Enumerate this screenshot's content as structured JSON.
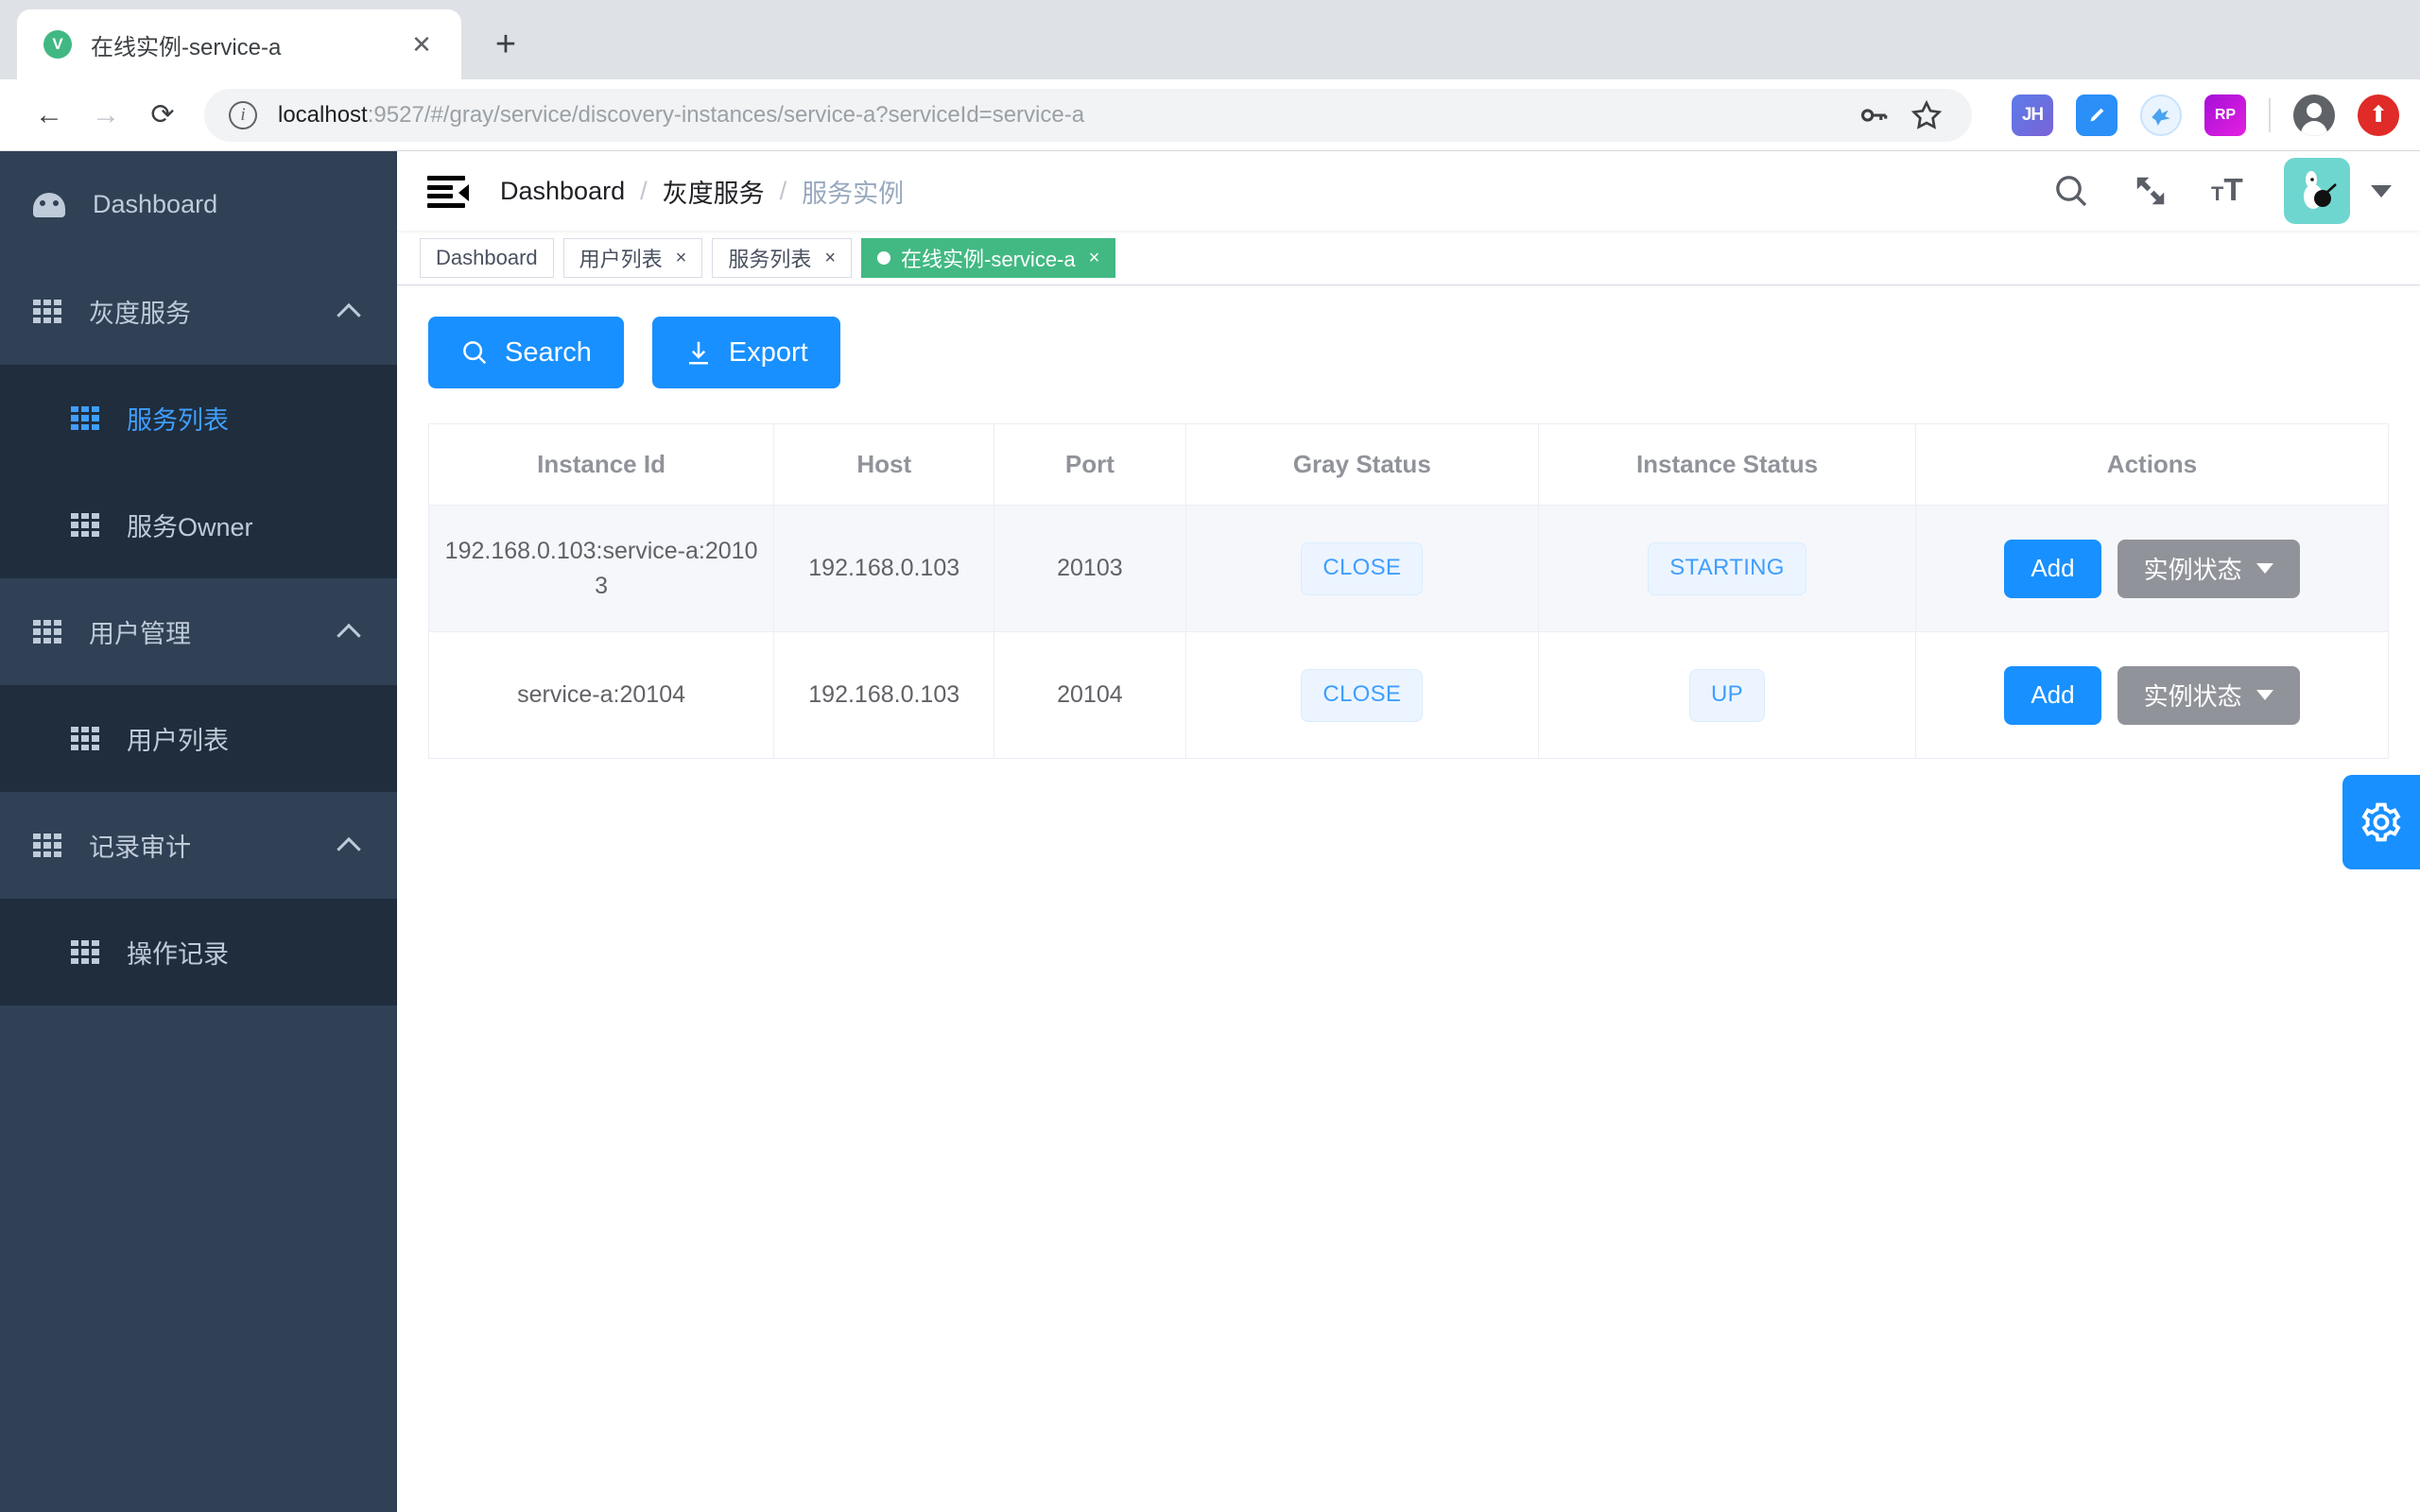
{
  "browser": {
    "tab": {
      "title": "在线实例-service-a",
      "favicon_letter": "V",
      "close_label": "✕"
    },
    "new_tab_label": "+",
    "url_host": "localhost",
    "url_path": ":9527/#/gray/service/discovery-instances/service-a?serviceId=service-a",
    "extensions": [
      {
        "name": "jh-extension",
        "label": "JH"
      },
      {
        "name": "blue-extension",
        "label": ""
      },
      {
        "name": "bird-extension",
        "label": ""
      },
      {
        "name": "rp-extension",
        "label": "RP"
      }
    ]
  },
  "sidebar": {
    "items": [
      {
        "label": "Dashboard",
        "icon": "gauge-icon",
        "type": "top",
        "active": false
      },
      {
        "label": "灰度服务",
        "icon": "grid-icon",
        "type": "group",
        "expanded": true
      },
      {
        "label": "服务列表",
        "icon": "grid-icon",
        "type": "sub",
        "active": true
      },
      {
        "label": "服务Owner",
        "icon": "grid-icon",
        "type": "sub",
        "active": false
      },
      {
        "label": "用户管理",
        "icon": "grid-icon",
        "type": "group",
        "expanded": true
      },
      {
        "label": "用户列表",
        "icon": "grid-icon",
        "type": "sub",
        "active": false
      },
      {
        "label": "记录审计",
        "icon": "grid-icon",
        "type": "group",
        "expanded": true
      },
      {
        "label": "操作记录",
        "icon": "grid-icon",
        "type": "sub",
        "active": false
      }
    ]
  },
  "navbar": {
    "breadcrumb": [
      "Dashboard",
      "灰度服务",
      "服务实例"
    ],
    "separator": "/",
    "icons": [
      "search-icon",
      "fullscreen-icon",
      "font-size-icon"
    ]
  },
  "tags_view": {
    "tags": [
      {
        "label": "Dashboard",
        "closable": false,
        "active": false
      },
      {
        "label": "用户列表",
        "closable": true,
        "active": false
      },
      {
        "label": "服务列表",
        "closable": true,
        "active": false
      },
      {
        "label": "在线实例-service-a",
        "closable": true,
        "active": true
      }
    ],
    "close_glyph": "×"
  },
  "toolbar": {
    "search_label": "Search",
    "export_label": "Export"
  },
  "table": {
    "columns": [
      "Instance Id",
      "Host",
      "Port",
      "Gray Status",
      "Instance Status",
      "Actions"
    ],
    "rows": [
      {
        "instance_id": "192.168.0.103:service-a:20103",
        "host": "192.168.0.103",
        "port": "20103",
        "gray_status": "CLOSE",
        "instance_status": "STARTING",
        "add_label": "Add",
        "dropdown_label": "实例状态"
      },
      {
        "instance_id": "service-a:20104",
        "host": "192.168.0.103",
        "port": "20104",
        "gray_status": "CLOSE",
        "instance_status": "UP",
        "add_label": "Add",
        "dropdown_label": "实例状态"
      }
    ]
  },
  "settings_fab": {
    "icon": "gear-icon"
  },
  "colors": {
    "primary": "#1890ff",
    "sidebar_bg": "#304156",
    "submenu_bg": "#1f2d3d",
    "active_tag_green": "#42b983",
    "tag_blue": "#409eff",
    "accent_avatar": "#6fd6cf"
  }
}
